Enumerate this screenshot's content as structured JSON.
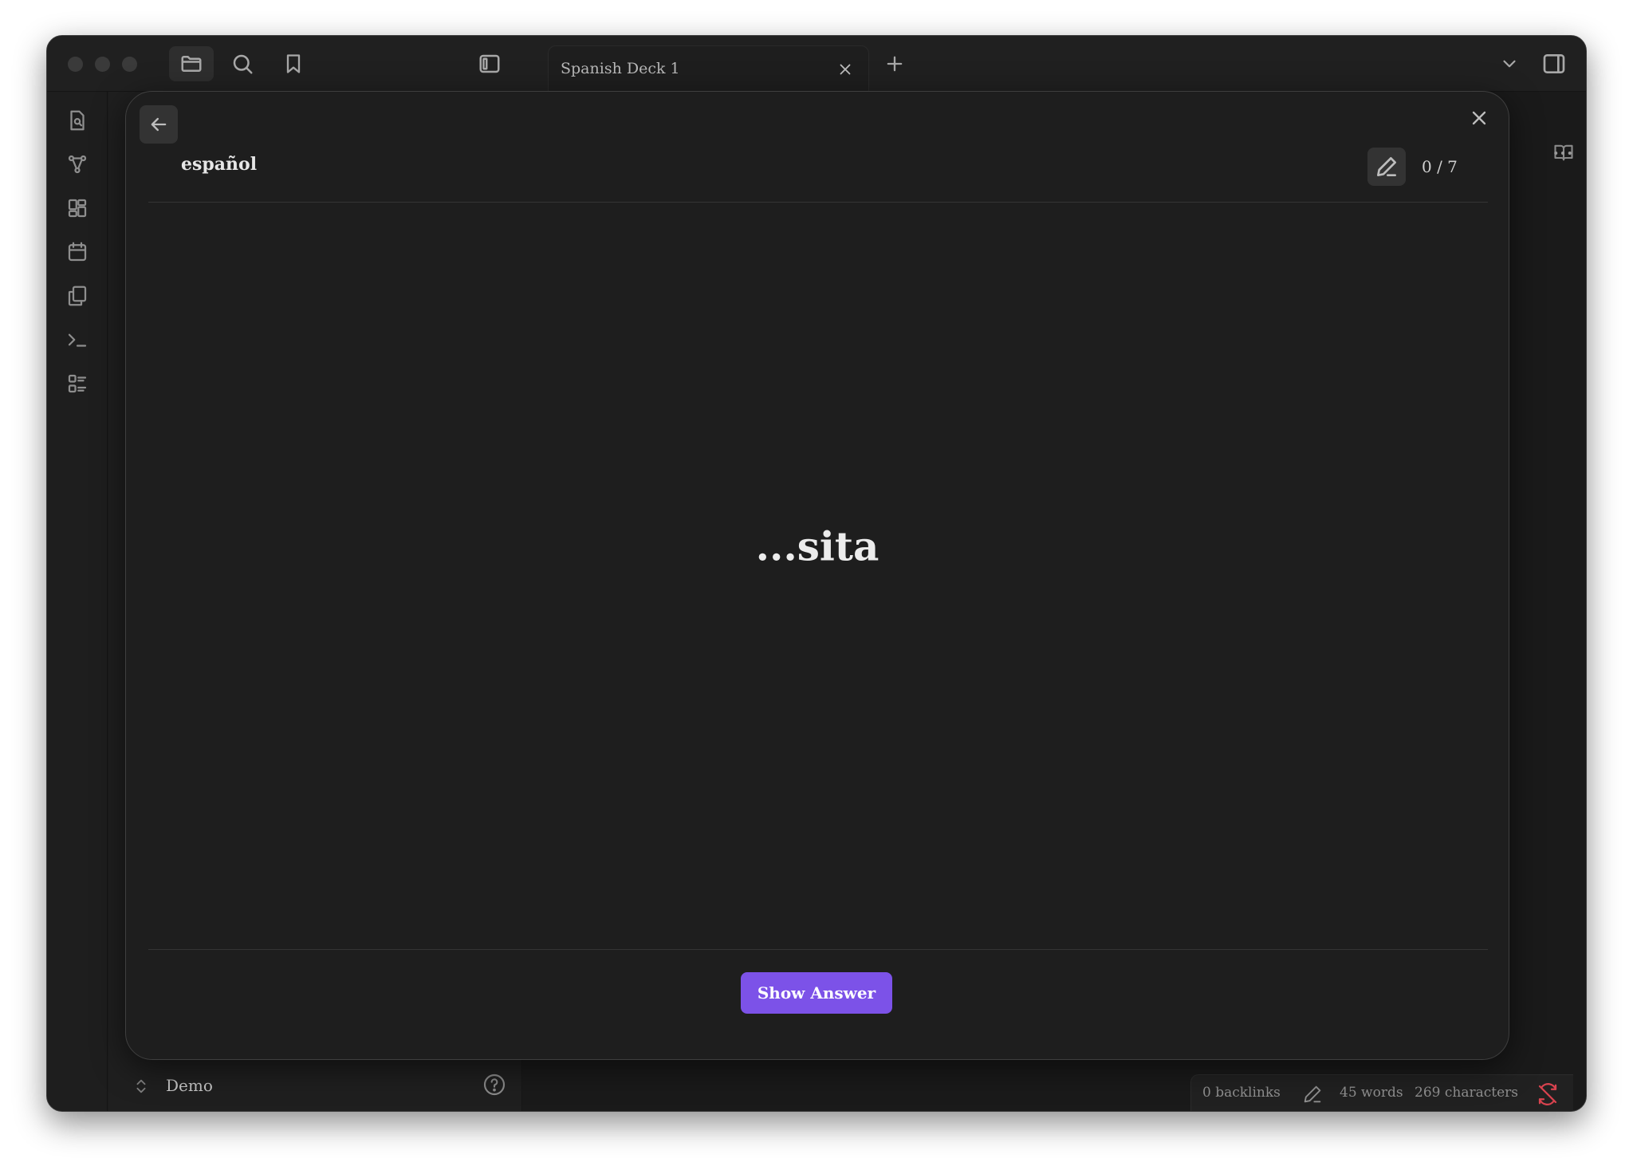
{
  "tab": {
    "label": "Spanish Deck 1"
  },
  "titlebar": {
    "icons": [
      "folder-icon",
      "search-icon",
      "bookmark-icon",
      "sidebar-toggle-icon",
      "new-tab-icon",
      "tab-list-chevron-icon",
      "right-sidebar-toggle-icon"
    ]
  },
  "ribbon": {
    "icons": [
      "open-quick-switcher-icon",
      "graph-view-icon",
      "canvas-icon",
      "daily-note-icon",
      "templates-icon",
      "command-palette-icon",
      "flashcards-icon"
    ]
  },
  "vault": {
    "name": "Demo"
  },
  "modal": {
    "deck_name": "español",
    "counter": "0 / 7",
    "card_front": "...sita",
    "show_answer_label": "Show Answer"
  },
  "status": {
    "backlinks": "0 backlinks",
    "words": "45 words",
    "characters": "269 characters"
  },
  "colors": {
    "accent": "#7c52e8",
    "background": "#1e1e1e",
    "sync_error": "#d9434f"
  }
}
